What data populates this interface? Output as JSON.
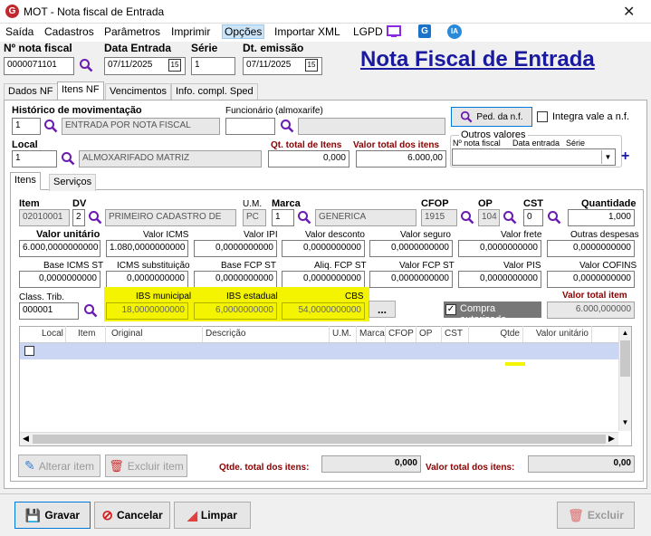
{
  "window": {
    "title": "MOT - Nota fiscal de Entrada"
  },
  "menu": [
    "Saída",
    "Cadastros",
    "Parâmetros",
    "Imprimir",
    "Opções",
    "Importar XML",
    "LGPD"
  ],
  "header": {
    "nf_label": "Nº nota fiscal",
    "nf_value": "0000071101",
    "data_entrada_label": "Data Entrada",
    "data_entrada_value": "07/11/2025",
    "serie_label": "Série",
    "serie_value": "1",
    "dt_emissao_label": "Dt. emissão",
    "dt_emissao_value": "07/11/2025",
    "big_title": "Nota Fiscal de Entrada",
    "cal_glyph": "15"
  },
  "main_tabs": [
    "Dados NF",
    "Itens NF",
    "Vencimentos",
    "Info. compl. Sped"
  ],
  "form": {
    "hist_label": "Histórico de movimentação",
    "hist_code": "1",
    "hist_desc": "ENTRADA POR NOTA FISCAL",
    "func_label": "Funcionário (almoxarife)",
    "func_code": "",
    "ped_btn": "Ped. da n.f.",
    "integra_label": "Integra vale a n.f.",
    "local_label": "Local",
    "local_code": "1",
    "local_desc": "ALMOXARIFADO MATRIZ",
    "qt_total_label": "Qt. total de Itens",
    "qt_total_value": "0,000",
    "valor_total_label": "Valor total dos itens",
    "valor_total_value": "6.000,00",
    "outros_label": "Outros valores",
    "outros_cols": [
      "Nº nota fiscal",
      "Data entrada",
      "Série"
    ],
    "plus": "+"
  },
  "sub_tabs": [
    "Itens",
    "Serviços"
  ],
  "item": {
    "item_label": "Item",
    "item_value": "02010001",
    "dv_label": "DV",
    "dv_value": "2",
    "desc_value": "PRIMEIRO CADASTRO DE",
    "um_label": "U.M.",
    "um_value": "PC",
    "marca_label": "Marca",
    "marca_code": "1",
    "marca_desc": "GENERICA",
    "cfop_label": "CFOP",
    "cfop_value": "1915",
    "op_label": "OP",
    "op_value": "104",
    "cst_label": "CST",
    "cst_value": "0",
    "qtd_label": "Quantidade",
    "qtd_value": "1,000"
  },
  "row1": [
    {
      "label": "Valor unitário",
      "value": "6.000,0000000000",
      "bold": true
    },
    {
      "label": "Valor ICMS",
      "value": "1.080,0000000000"
    },
    {
      "label": "Valor IPI",
      "value": "0,0000000000"
    },
    {
      "label": "Valor desconto",
      "value": "0,0000000000"
    },
    {
      "label": "Valor seguro",
      "value": "0,0000000000"
    },
    {
      "label": "Valor frete",
      "value": "0,0000000000"
    },
    {
      "label": "Outras despesas",
      "value": "0,0000000000"
    }
  ],
  "row2": [
    {
      "label": "Base ICMS ST",
      "value": "0,0000000000"
    },
    {
      "label": "ICMS substituição",
      "value": "0,0000000000"
    },
    {
      "label": "Base FCP ST",
      "value": "0,0000000000"
    },
    {
      "label": "Aliq. FCP ST",
      "value": "0,0000000000"
    },
    {
      "label": "Valor FCP ST",
      "value": "0,0000000000"
    },
    {
      "label": "Valor PIS",
      "value": "0,0000000000"
    },
    {
      "label": "Valor COFINS",
      "value": "0,0000000000"
    }
  ],
  "row3": {
    "class_label": "Class. Trib.",
    "class_value": "000001",
    "ibs_mun_label": "IBS municipal",
    "ibs_mun_value": "18,0000000000",
    "ibs_est_label": "IBS estadual",
    "ibs_est_value": "6,0000000000",
    "cbs_label": "CBS",
    "cbs_value": "54,0000000000",
    "dots": "...",
    "compra_label": "Compra autorizada",
    "valor_total_item_label": "Valor total item",
    "valor_total_item_value": "6.000,000000"
  },
  "grid": {
    "columns": [
      "Local",
      "Item",
      "Original",
      "Descrição",
      "U.M.",
      "Marca",
      "CFOP",
      "OP",
      "CST",
      "Qtde",
      "Valor unitário"
    ]
  },
  "footer": {
    "alterar": "Alterar item",
    "excluir_item": "Excluir item",
    "qtde_total_label": "Qtde. total dos itens:",
    "qtde_total_value": "0,000",
    "valor_total_label": "Valor total dos itens:",
    "valor_total_value": "0,00"
  },
  "actions": {
    "gravar": "Gravar",
    "cancelar": "Cancelar",
    "limpar": "Limpar",
    "excluir": "Excluir"
  },
  "colors": {
    "accent": "#1a1aa0",
    "yellow": "#f4f400",
    "dark_red": "#8b0000"
  }
}
